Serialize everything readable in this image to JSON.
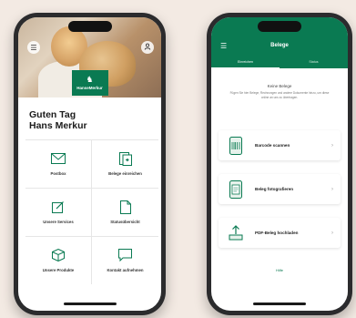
{
  "left_phone": {
    "brand": {
      "name": "HanseMerkur"
    },
    "greeting": {
      "line1": "Guten Tag",
      "line2": "Hans Merkur"
    },
    "tiles": [
      {
        "label": "Postbox",
        "icon": "mail-icon"
      },
      {
        "label": "Belege einreichen",
        "icon": "document-submit-icon"
      },
      {
        "label": "Unsere Services",
        "icon": "edit-icon"
      },
      {
        "label": "Statusübersicht",
        "icon": "document-status-icon"
      },
      {
        "label": "Unsere Produkte",
        "icon": "box-icon"
      },
      {
        "label": "Kontakt aufnehmen",
        "icon": "chat-icon"
      }
    ]
  },
  "right_phone": {
    "header": {
      "title": "Belege"
    },
    "tabs": [
      {
        "label": "Einreichen",
        "active": true
      },
      {
        "label": "Status",
        "active": false
      }
    ],
    "empty_state": {
      "title": "Keine Belege",
      "text": "Fügen Sie hier Belege, Rechnungen und andere Dokumente hinzu, um diese online an uns zu übertragen."
    },
    "actions": [
      {
        "label": "Barcode scannen",
        "icon": "barcode-scan-icon"
      },
      {
        "label": "Beleg fotografieren",
        "icon": "camera-icon"
      },
      {
        "label": "PDF-Beleg hochladen",
        "icon": "upload-icon"
      }
    ],
    "help_link": "Hilfe"
  },
  "colors": {
    "brand_green": "#0a7a52",
    "background": "#f3eae3"
  }
}
